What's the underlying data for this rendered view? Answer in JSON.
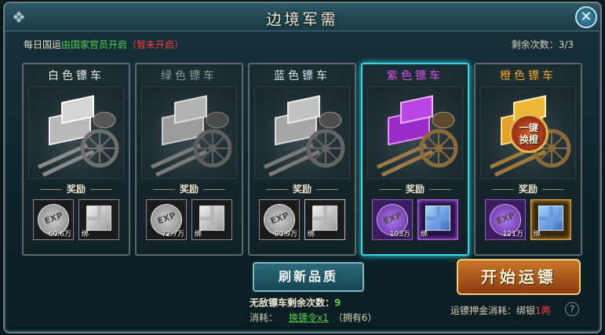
{
  "window": {
    "title": "边境军需"
  },
  "header": {
    "info_prefix": "每日国运",
    "info_highlight": "由国家官员开启",
    "info_status": "（暂未开启）",
    "remaining_label": "剩余次数：",
    "remaining_value": "3/3"
  },
  "cards": [
    {
      "name": "白色镖车",
      "title_color": "#f2efe6",
      "reward_label": "奖励",
      "exp_icon_text": "EXP",
      "exp_amount": "60.6万",
      "box_bind": "绑"
    },
    {
      "name": "绿色镖车",
      "title_color": "#8f9a93",
      "reward_label": "奖励",
      "exp_icon_text": "EXP",
      "exp_amount": "72.7万",
      "box_bind": "绑"
    },
    {
      "name": "蓝色镖车",
      "title_color": "#d7e5ec",
      "reward_label": "奖励",
      "exp_icon_text": "EXP",
      "exp_amount": "90.9万",
      "box_bind": "绑"
    },
    {
      "name": "紫色镖车",
      "title_color": "#e04cf0",
      "reward_label": "奖励",
      "exp_icon_text": "EXP",
      "exp_amount": "103万",
      "box_bind": "绑"
    },
    {
      "name": "橙色镖车",
      "title_color": "#f5a623",
      "reward_label": "奖励",
      "exp_icon_text": "EXP",
      "exp_amount": "121万",
      "box_bind": "绑"
    }
  ],
  "quick_upgrade": {
    "line1": "一键",
    "line2": "换橙"
  },
  "actions": {
    "refresh_label": "刷新品质",
    "start_label": "开始运镖"
  },
  "footer": {
    "invincible_label": "无敌镖车剩余次数：",
    "invincible_value": "9",
    "cost_label": "消耗：",
    "cost_item": "换镖令x1",
    "cost_owned": "（拥有6）",
    "deposit_label": "运镖押金消耗：绑银",
    "deposit_value": "1两",
    "help_glyph": "?"
  },
  "colors": {
    "selected_border": "#35d8e6",
    "green_text": "#4fd04a",
    "red_text": "#ff3b3b"
  }
}
